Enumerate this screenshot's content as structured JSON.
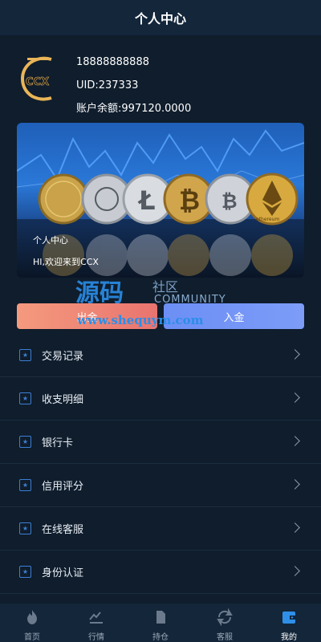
{
  "header": {
    "title": "个人中心"
  },
  "profile": {
    "logo_text": "CCX",
    "phone": "18888888888",
    "uid": "UID:237333",
    "balance": "账户余额:997120.0000"
  },
  "banner": {
    "title": "个人中心",
    "subtitle": "HI,欢迎来到CCX",
    "coin_text": "ethereum"
  },
  "actions": {
    "withdraw": "出金",
    "deposit": "入金"
  },
  "watermark": {
    "big": "源码",
    "small": "社区",
    "community": "COMMUNITY",
    "url": "www.shequym.com"
  },
  "menu": [
    {
      "label": "交易记录"
    },
    {
      "label": "收支明细"
    },
    {
      "label": "银行卡"
    },
    {
      "label": "信用评分"
    },
    {
      "label": "在线客服"
    },
    {
      "label": "身份认证"
    }
  ],
  "tabbar": [
    {
      "label": "首页",
      "icon": "flame-icon"
    },
    {
      "label": "行情",
      "icon": "chart-icon"
    },
    {
      "label": "持仓",
      "icon": "document-icon"
    },
    {
      "label": "客服",
      "icon": "refresh-icon"
    },
    {
      "label": "我的",
      "icon": "wallet-icon",
      "active": true
    }
  ],
  "colors": {
    "accent": "#3d7fd4",
    "background": "#0f1d2c",
    "header": "#13263a"
  }
}
